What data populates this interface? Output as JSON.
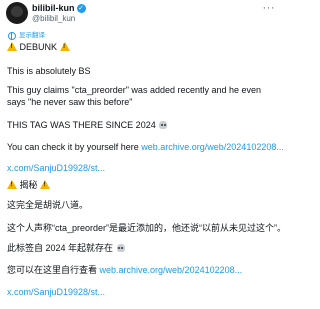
{
  "author": {
    "display_name": "bilibil-kun",
    "handle": "@bilibil_kun"
  },
  "translate_label": "显示翻译",
  "post": {
    "en_title": "DEBUNK",
    "en_line1": "This is absolutely BS",
    "en_line2": "This guy claims \"cta_preorder\" was added recently and he even says \"he never saw this before\"",
    "en_line3": "THIS TAG WAS THERE SINCE 2024",
    "en_line4_prefix": "You can check it by yourself here ",
    "en_link1": "web.archive.org/web/2024102208...",
    "en_link2": "x.com/SanjuD19928/st...",
    "zh_title": "揭秘",
    "zh_line1": "这完全是胡说八道。",
    "zh_line2": "这个人声称“cta_preorder”是最近添加的，他还说“以前从未见过这个”。",
    "zh_line3": "此标签自 2024 年起就存在",
    "zh_line4_prefix": "您可以在这里自行查看 ",
    "zh_link1": "web.archive.org/web/2024102208...",
    "zh_link2": "x.com/SanjuD19928/st..."
  },
  "icons": {
    "warning": "warning-icon",
    "skull": "skull-icon",
    "verified": "verified-badge-icon",
    "more": "more-options-icon",
    "globe": "globe-icon"
  },
  "colors": {
    "link": "#1d9bf0",
    "text": "#0f1419",
    "secondary": "#536471"
  }
}
